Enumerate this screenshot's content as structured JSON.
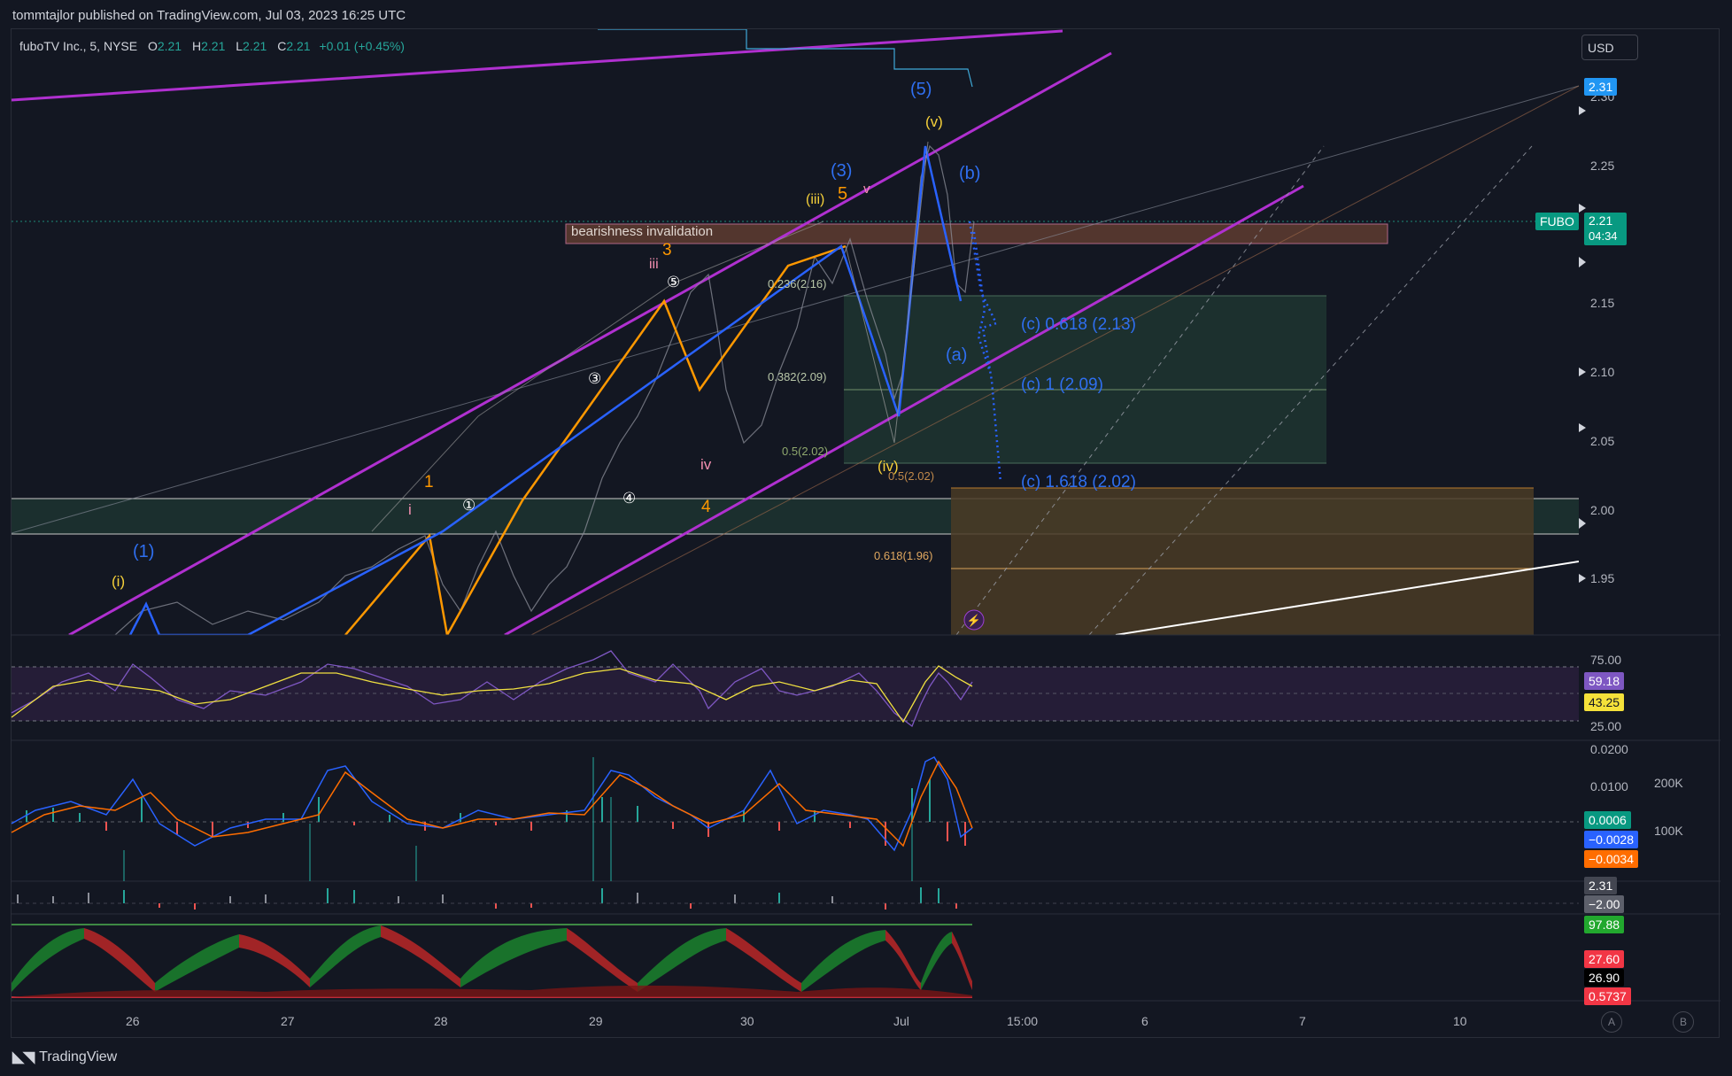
{
  "header": {
    "publisher_line": "tommtajlor published on TradingView.com, Jul 03, 2023 16:25 UTC"
  },
  "symbol": {
    "name": "fuboTV Inc., 5, NYSE",
    "open_label": "O",
    "open": "2.21",
    "high_label": "H",
    "high": "2.21",
    "low_label": "L",
    "low": "2.21",
    "close_label": "C",
    "close": "2.21",
    "change": "+0.01 (+0.45%)"
  },
  "currency_button": "USD",
  "price_axis": {
    "ticks": [
      "2.30",
      "2.25",
      "2.20",
      "2.15",
      "2.10",
      "2.05",
      "2.00",
      "1.95"
    ],
    "last_price_tag": "2.31",
    "ticker_tag": "FUBO",
    "current_price": "2.21",
    "countdown": "04:34"
  },
  "annotations": {
    "invalidation_label": "bearishness invalidation",
    "fib_0236": "0.236(2.16)",
    "fib_0382": "0.382(2.09)",
    "fib_05": "0.5(2.02)",
    "fib_05b": "0.5(2.02)",
    "fib_0618": "0.618(1.96)",
    "target_0618": "(c) 0.618 (2.13)",
    "target_1": "(c) 1 (2.09)",
    "target_1618": "(c) 1.618 (2.02)",
    "wave_5_blue": "(5)",
    "wave_v_yellow": "(v)",
    "wave_b": "(b)",
    "wave_a": "(a)",
    "wave_3_blue": "(3)",
    "wave_iii_yellow": "(iii)",
    "wave_5_orange": "5",
    "wave_v_small": "v",
    "wave_3_orange": "3",
    "wave_iii_pink": "iii",
    "wave_iv_pink": "iv",
    "wave_iv_yellow": "(iv)",
    "wave_4_orange": "4",
    "wave_1_orange": "1",
    "wave_i_pink": "i",
    "wave_1_blue": "(1)",
    "wave_i_yellow": "(i)",
    "circle_1": "①",
    "circle_3": "③",
    "circle_4": "④",
    "circle_5": "⑤"
  },
  "rsi_pane": {
    "upper": "75.00",
    "lower": "25.00",
    "value": "59.18",
    "signal": "43.25"
  },
  "macd_pane": {
    "top": "0.0200",
    "mid": "0.0100",
    "hist": "0.0006",
    "macd": "−0.0028",
    "signal": "−0.0034",
    "vol_200k": "200K",
    "vol_100k": "100K"
  },
  "pane3": {
    "a": "2.31",
    "b": "−2.00"
  },
  "pane4": {
    "a": "97.88",
    "b": "27.60",
    "c": "26.90",
    "d": "0.5737"
  },
  "time_axis": [
    "26",
    "27",
    "28",
    "29",
    "30",
    "Jul",
    "15:00",
    "6",
    "7",
    "10"
  ],
  "footer": {
    "brand": "TradingView"
  },
  "bottom_buttons": {
    "a": "A",
    "b": "B"
  },
  "colors": {
    "purple_channel": "#b030d0",
    "blue_wave": "#2962ff",
    "orange_wave": "#ff9800",
    "green_tag": "#089981",
    "sky_tag": "#2196f3",
    "red_tag": "#f23645"
  }
}
